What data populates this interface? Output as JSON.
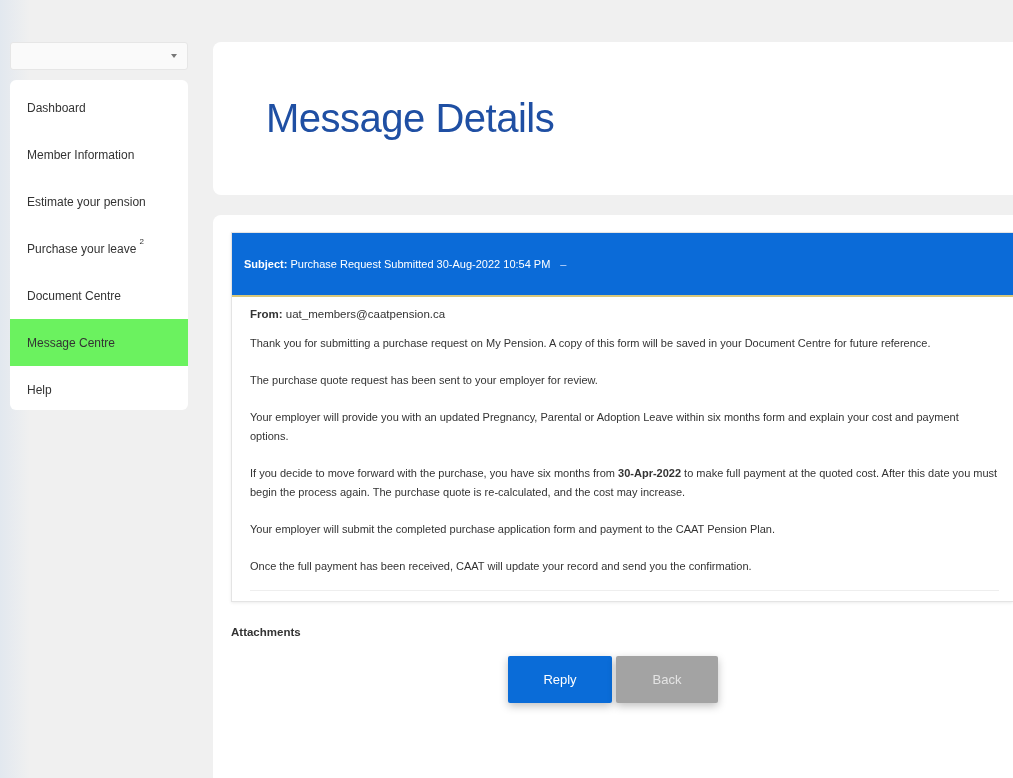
{
  "sidebar": {
    "account_selector": {
      "expanded": false
    },
    "items": [
      {
        "label": "Dashboard",
        "selected": false
      },
      {
        "label": "Member Information",
        "selected": false
      },
      {
        "label": "Estimate your pension",
        "selected": false
      },
      {
        "label": "Purchase your leave $^{2}$",
        "selected": false
      },
      {
        "label": "Document Centre",
        "selected": false
      },
      {
        "label": "Message Centre",
        "selected": true
      },
      {
        "label": "Help",
        "selected": false
      }
    ]
  },
  "page_title": "Message Details",
  "message": {
    "subject": "**Subject:** Purchase Request Submitted 30-Aug-2022 10:54 PM",
    "toggle": "–",
    "from": "**From:** uat_members@caatpension.ca",
    "paragraphs": [
      "Thank you for submitting a purchase request on My Pension. A copy of this form will be saved in your Document Centre for future reference.",
      "The purchase quote request has been sent to your employer for review.",
      "Your employer will provide you with an updated Pregnancy, Parental or Adoption Leave within six months form and explain your cost and payment options.",
      "If you decide to move forward with the purchase, you have six months from **30-Apr-2022** to make full payment at the quoted cost. After this date you must begin the process again. The purchase quote is re-calculated, and the cost may increase.",
      "Your employer will submit the completed purchase application form and payment to the CAAT Pension Plan.",
      "Once the full payment has been received, CAAT will update your record and send you the confirmation."
    ]
  },
  "attachments_label": "Attachments",
  "buttons": [
    {
      "label": "Reply",
      "disabled": false
    },
    {
      "label": "Back",
      "disabled": true
    }
  ]
}
